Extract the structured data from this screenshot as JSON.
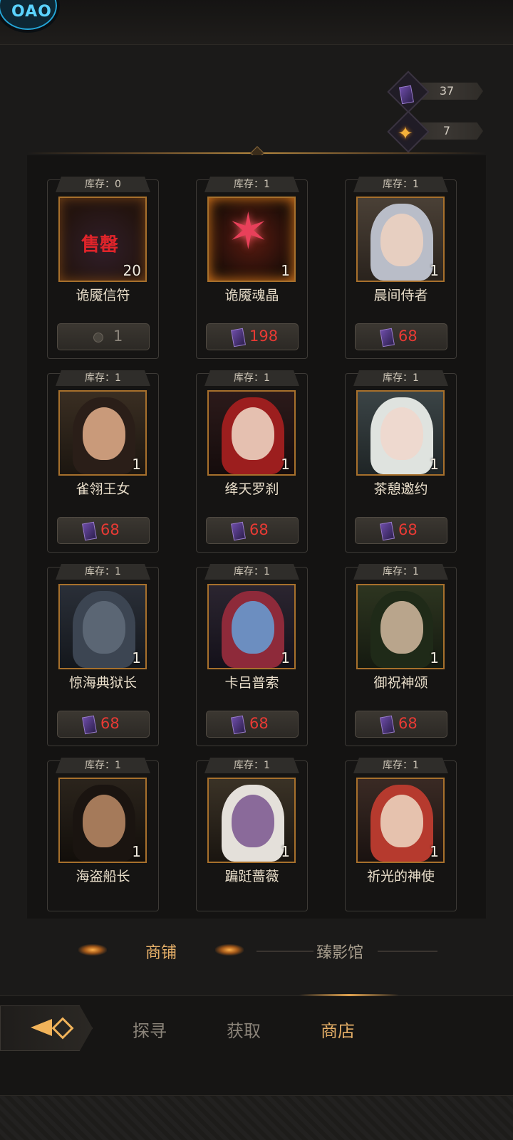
{
  "currencies": [
    {
      "icon": "purple-card-icon",
      "value": "37"
    },
    {
      "icon": "gold-star-icon",
      "value": "7"
    }
  ],
  "logo": {
    "text": "OAO"
  },
  "items": [
    {
      "stock": "库存：0",
      "name": "诡魇信符",
      "qty": "20",
      "price": "1",
      "price_icon": "grey-coin-icon",
      "soldout": "售罄",
      "art": "dark-card-art"
    },
    {
      "stock": "库存：1",
      "name": "诡魇魂晶",
      "qty": "1",
      "price": "198",
      "price_icon": "purple-card-icon",
      "art": "red-crystal-art"
    },
    {
      "stock": "库存：1",
      "name": "晨间侍者",
      "qty": "1",
      "price": "68",
      "price_icon": "purple-card-icon",
      "art": "silver-hair-elf-portrait"
    },
    {
      "stock": "库存：1",
      "name": "雀翎王女",
      "qty": "1",
      "price": "68",
      "price_icon": "purple-card-icon",
      "art": "veiled-princess-portrait"
    },
    {
      "stock": "库存：1",
      "name": "绛天罗刹",
      "qty": "1",
      "price": "68",
      "price_icon": "purple-card-icon",
      "art": "red-hair-demon-portrait"
    },
    {
      "stock": "库存：1",
      "name": "茶憩邀约",
      "qty": "1",
      "price": "68",
      "price_icon": "purple-card-icon",
      "art": "white-hair-elf-portrait"
    },
    {
      "stock": "库存：1",
      "name": "惊海典狱长",
      "qty": "1",
      "price": "68",
      "price_icon": "purple-card-icon",
      "art": "werewolf-portrait"
    },
    {
      "stock": "库存：1",
      "name": "卡吕普索",
      "qty": "1",
      "price": "68",
      "price_icon": "purple-card-icon",
      "art": "blue-siren-portrait"
    },
    {
      "stock": "库存：1",
      "name": "御祝神颂",
      "qty": "1",
      "price": "68",
      "price_icon": "purple-card-icon",
      "art": "horned-goddess-portrait"
    },
    {
      "stock": "库存：1",
      "name": "海盗船长",
      "qty": "1",
      "price": "",
      "price_icon": "",
      "art": "pirate-captain-portrait"
    },
    {
      "stock": "库存：1",
      "name": "蹁跹蔷薇",
      "qty": "1",
      "price": "",
      "price_icon": "",
      "art": "white-hair-dark-elf-portrait"
    },
    {
      "stock": "库存：1",
      "name": "祈光的神使",
      "qty": "1",
      "price": "",
      "price_icon": "",
      "art": "rose-crown-girl-portrait"
    }
  ],
  "shop_tabs": [
    {
      "label": "商铺",
      "active": true
    },
    {
      "label": "臻影馆",
      "active": false
    }
  ],
  "bottom_nav": [
    {
      "label": "探寻",
      "active": false
    },
    {
      "label": "获取",
      "active": false
    },
    {
      "label": "商店",
      "active": true
    }
  ],
  "colors": {
    "price_red": "#e83a34",
    "accent_gold": "#e3ad66",
    "frame_bronze": "#a7702c"
  }
}
